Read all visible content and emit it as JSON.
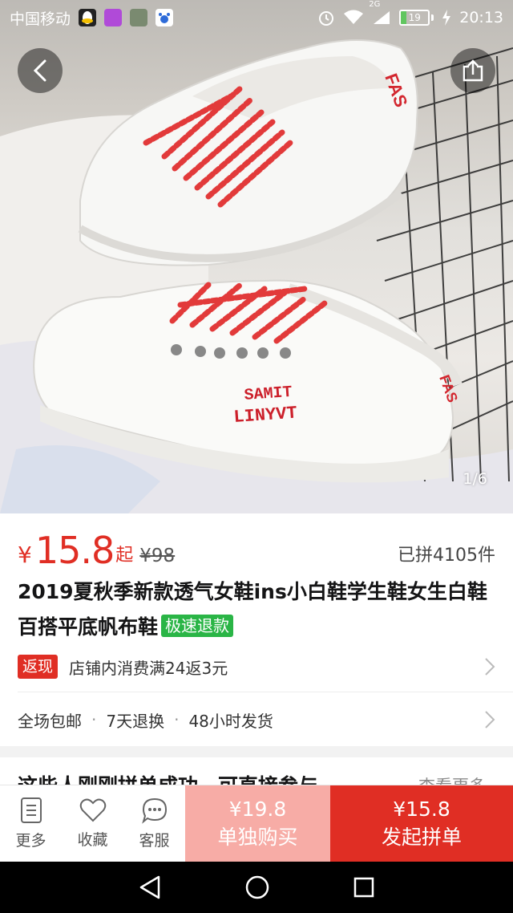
{
  "status_bar": {
    "carrier": "中国移动",
    "network": "2G",
    "battery": "19",
    "battery_level": 0.19,
    "time": "20:13",
    "icons": [
      "qq-icon",
      "gallery-app-icon",
      "photo-app-icon",
      "baidu-app-icon",
      "alarm-icon",
      "wifi-icon",
      "signal-icon",
      "battery-icon",
      "charging-icon"
    ]
  },
  "gallery": {
    "page_indicator": "1/6",
    "back_icon": "chevron-left-icon",
    "share_icon": "share-icon"
  },
  "price_section": {
    "currency": "¥",
    "price": "15.8",
    "price_suffix": "起",
    "original_price": "¥98",
    "sold_count": "已拼4105件"
  },
  "product": {
    "title": "2019夏秋季新款透气女鞋ins小白鞋学生鞋女生白鞋百搭平底帆布鞋",
    "tag": "极速退款"
  },
  "promo": {
    "badge": "返现",
    "text": "店铺内消费满24返3元"
  },
  "services": [
    "全场包邮",
    "7天退换",
    "48小时发货"
  ],
  "group_section": {
    "title": "这些人刚刚拼单成功，可直接参与",
    "more": "查看更多"
  },
  "action_bar": {
    "more_label": "更多",
    "favorite_label": "收藏",
    "service_label": "客服",
    "buy_alone_price": "¥19.8",
    "buy_alone_label": "单独购买",
    "group_buy_price": "¥15.8",
    "group_buy_label": "发起拼单"
  },
  "colors": {
    "accent_red": "#e02e24",
    "light_red": "#f7aca6",
    "tag_green": "#2ab546"
  }
}
